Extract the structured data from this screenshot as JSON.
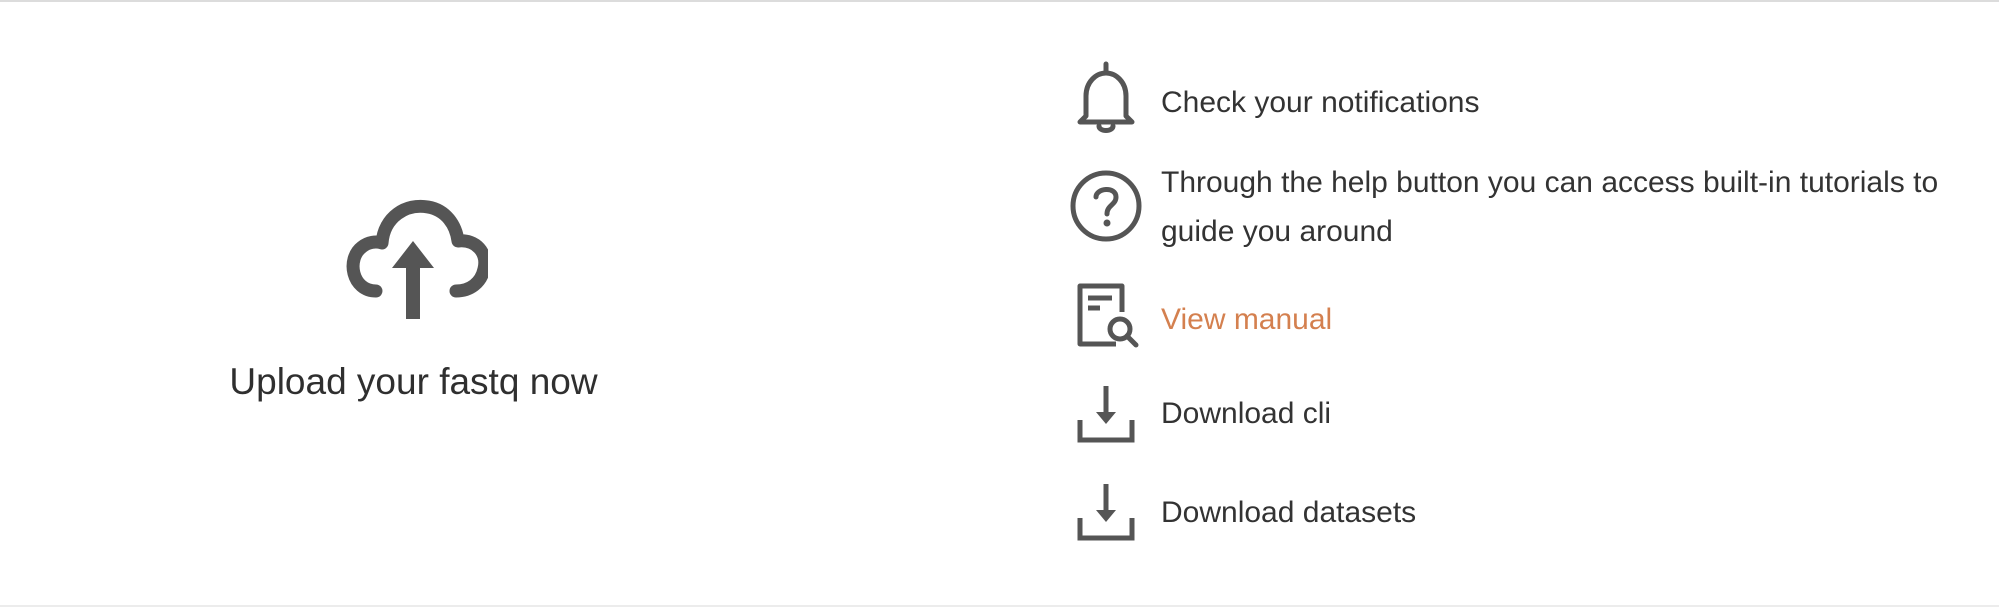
{
  "upload": {
    "label": "Upload your fastq now",
    "icon": "cloud-upload-icon"
  },
  "info_items": [
    {
      "icon": "bell-icon",
      "text": "Check your notifications"
    },
    {
      "icon": "help-circle-icon",
      "text": "Through the help button you can access built-in tutorials to guide you around"
    },
    {
      "icon": "manual-search-icon",
      "text": "View manual"
    },
    {
      "icon": "download-icon",
      "text": "Download cli"
    },
    {
      "icon": "download-icon",
      "text": "Download datasets"
    }
  ],
  "colors": {
    "icon": "#555555",
    "text": "#333333",
    "link": "#d4804f",
    "rule": "#dcdcdc"
  }
}
